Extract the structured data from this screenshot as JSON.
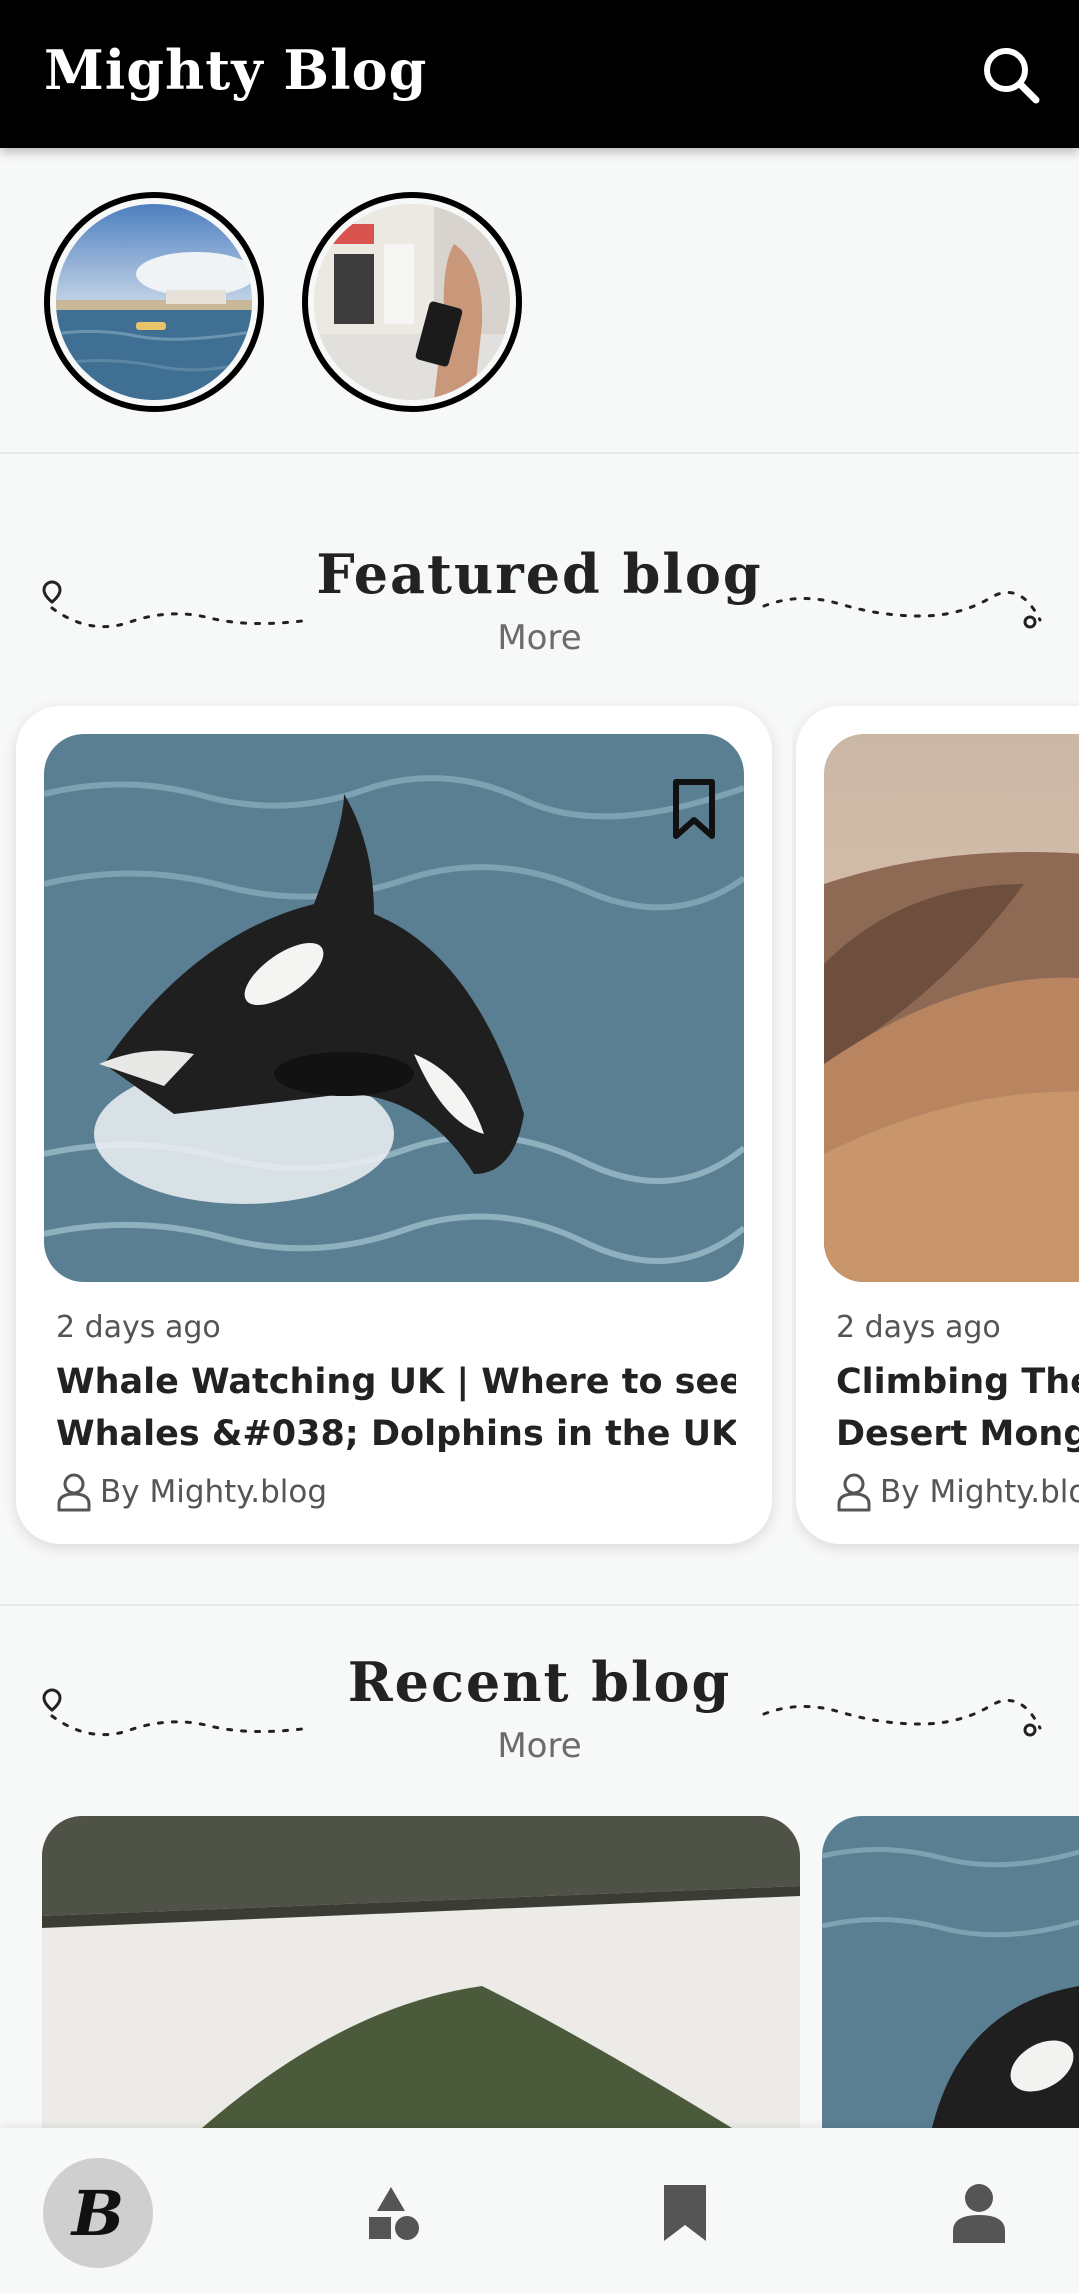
{
  "header": {
    "title": "Mighty Blog",
    "search_icon": "search-icon"
  },
  "stories": [
    {
      "name": "story-harbor",
      "icon": "image"
    },
    {
      "name": "story-street",
      "icon": "image"
    }
  ],
  "featured": {
    "title": "Featured blog",
    "more_label": "More",
    "cards": [
      {
        "date": "2 days ago",
        "title_line1": "Whale Watching UK | Where to see",
        "title_line2": "Whales &#038; Dolphins in the UK",
        "author": "By Mighty.blog"
      },
      {
        "date": "2 days ago",
        "title_line1": "Climbing The S",
        "title_line2": "Desert Mongo",
        "author": "By Mighty.blo"
      }
    ]
  },
  "recent": {
    "title": "Recent blog",
    "more_label": "More"
  },
  "nav": {
    "items": [
      "home-logo-icon",
      "categories-icon",
      "bookmark-icon",
      "profile-icon"
    ],
    "home_glyph": "B"
  },
  "colors": {
    "topbar": "#000000",
    "background": "#f7f8f8",
    "nav_active": "#cfcfcf",
    "icon": "#555555"
  }
}
